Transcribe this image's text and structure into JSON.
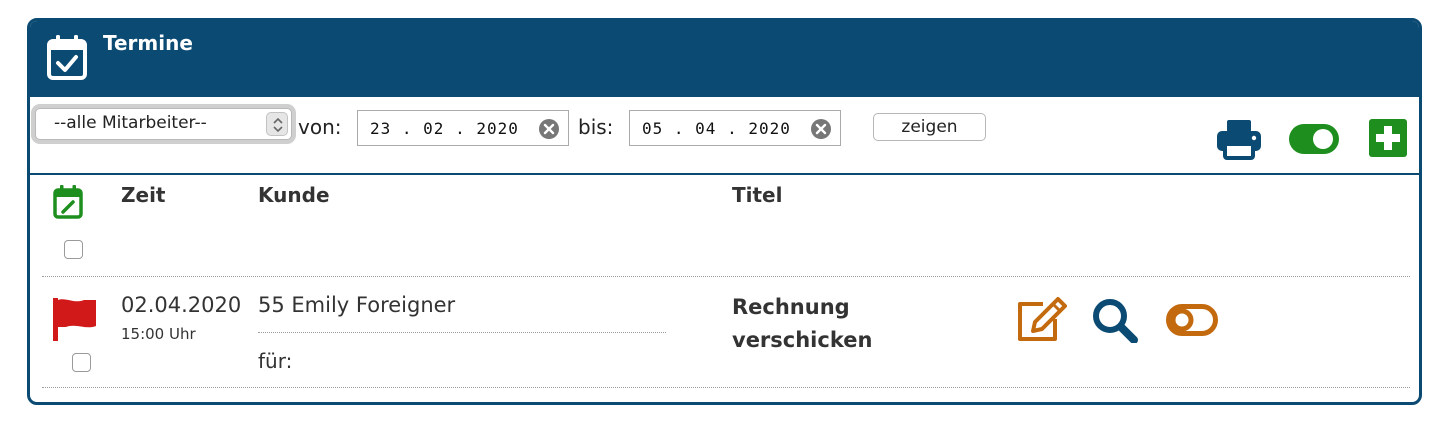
{
  "header": {
    "title": "Termine",
    "icon": "calendar-check-icon"
  },
  "filter": {
    "employee_select": {
      "selected": "--alle Mitarbeiter--"
    },
    "from_label": "von:",
    "from_date": "23 . 02 . 2020",
    "to_label": "bis:",
    "to_date": "05 . 04 . 2020",
    "show_button": "zeigen"
  },
  "toolbar_icons": [
    "print-icon",
    "toggle-on-icon",
    "add-icon"
  ],
  "colors": {
    "primary": "#0b4a73",
    "green": "#1e8f1e",
    "orange": "#c46a0e",
    "red": "#d11919"
  },
  "table": {
    "headers": {
      "zeit": "Zeit",
      "kunde": "Kunde",
      "titel": "Titel"
    },
    "rows": [
      {
        "date": "02.04.2020",
        "time": "15:00 Uhr",
        "kunde": "55 Emily Foreigner",
        "fuer": "für:",
        "titel": "Rechnung verschicken",
        "actions": [
          "edit-icon",
          "search-icon",
          "toggle-off-icon"
        ]
      }
    ]
  }
}
